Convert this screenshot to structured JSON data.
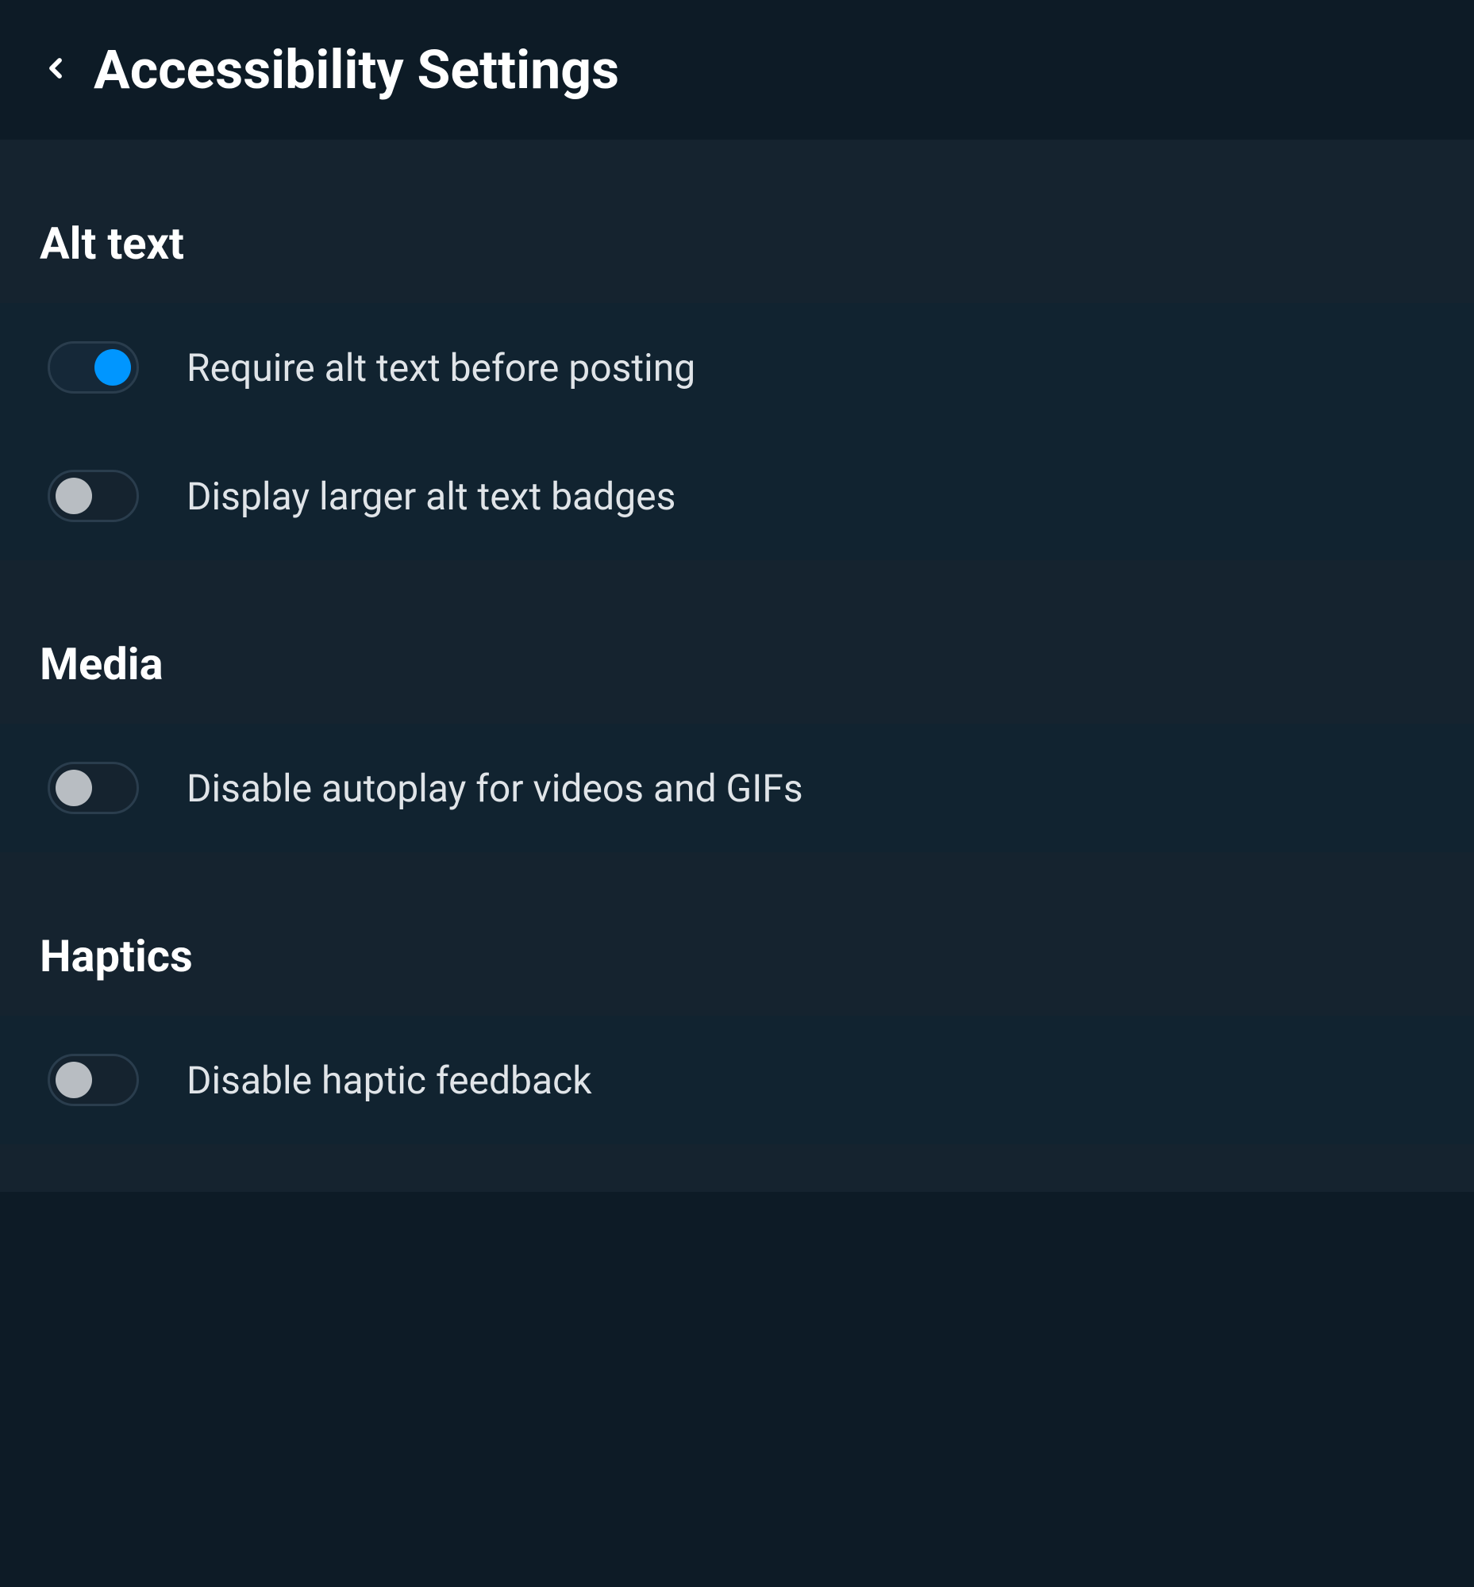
{
  "header": {
    "title": "Accessibility Settings"
  },
  "sections": {
    "altText": {
      "title": "Alt text",
      "requireAltText": {
        "label": "Require alt text before posting",
        "enabled": true
      },
      "largerBadges": {
        "label": "Display larger alt text badges",
        "enabled": false
      }
    },
    "media": {
      "title": "Media",
      "disableAutoplay": {
        "label": "Disable autoplay for videos and GIFs",
        "enabled": false
      }
    },
    "haptics": {
      "title": "Haptics",
      "disableHaptic": {
        "label": "Disable haptic feedback",
        "enabled": false
      }
    }
  }
}
